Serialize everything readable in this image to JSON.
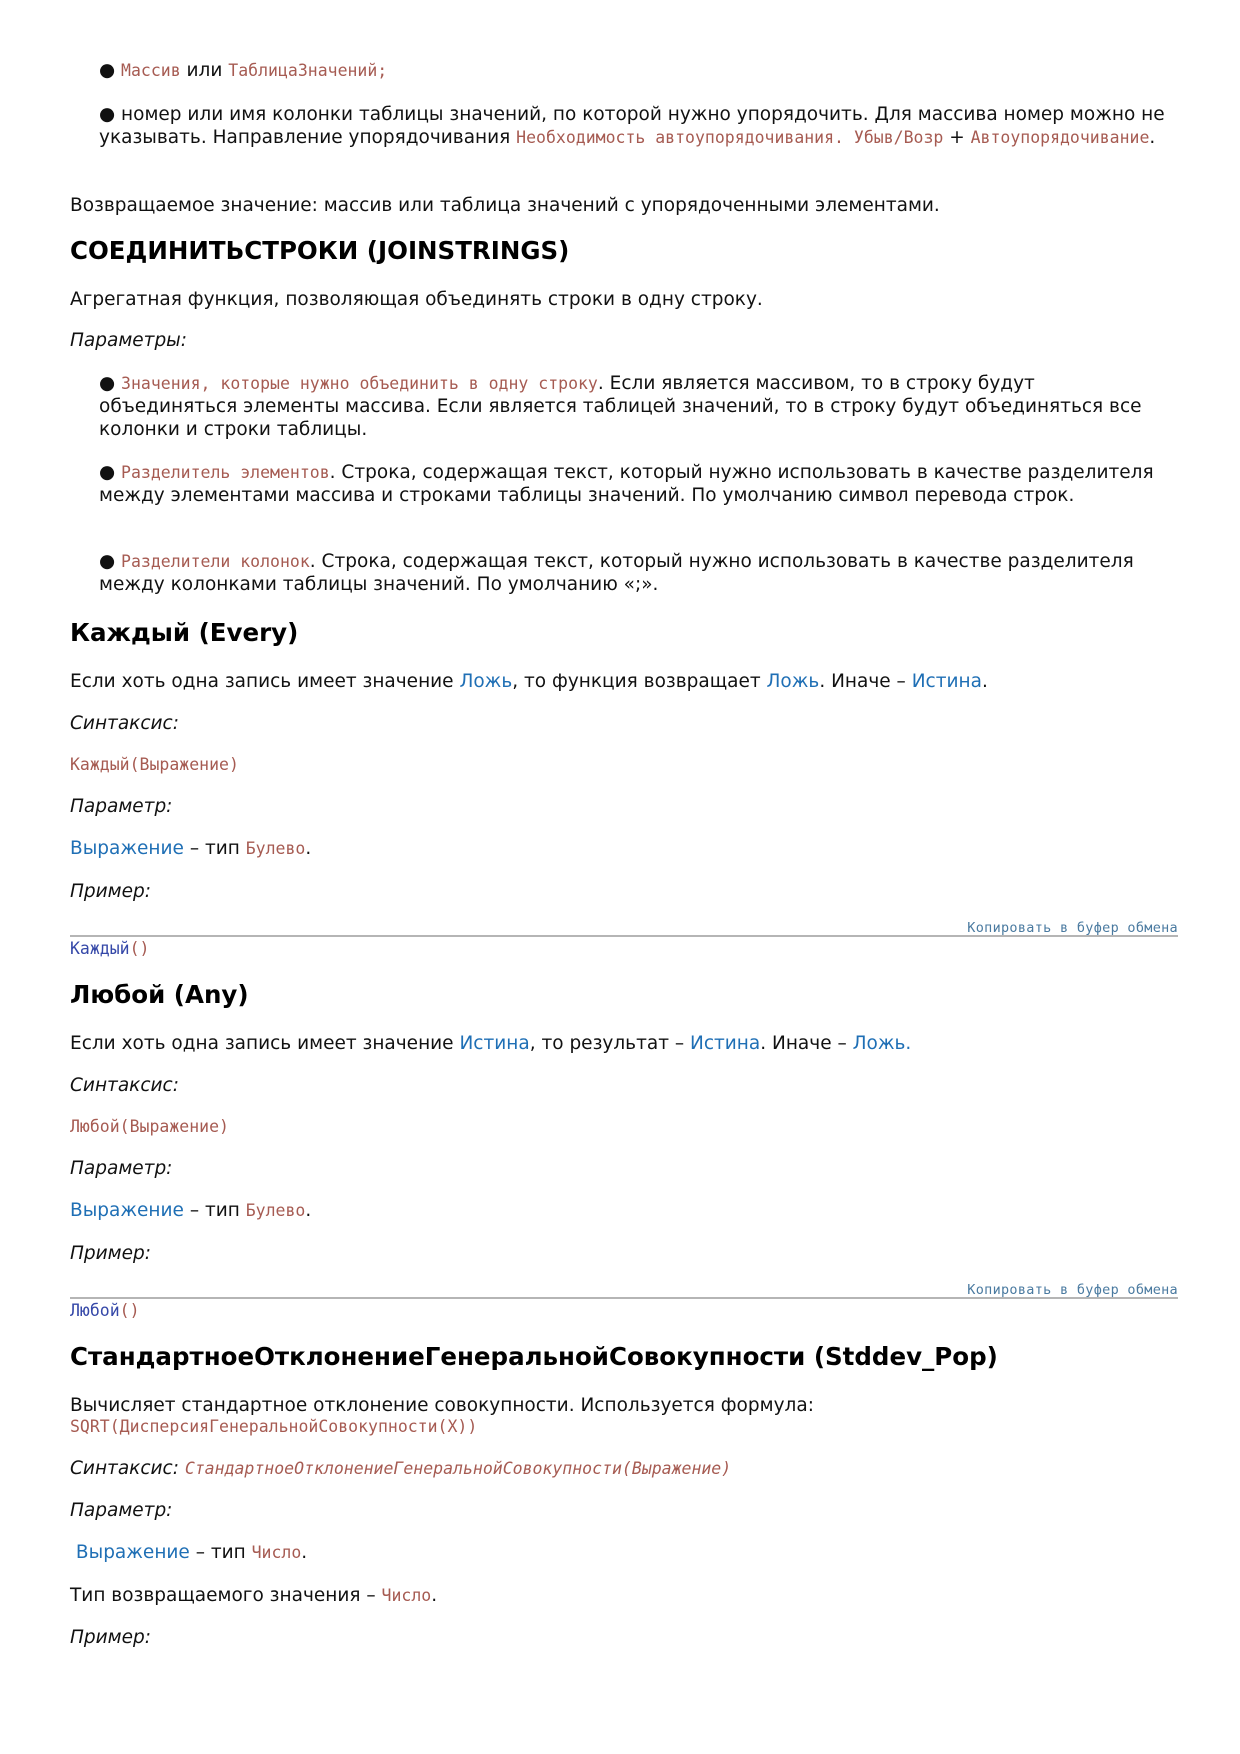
{
  "bullet": "●",
  "top": {
    "item1": {
      "code1": "Массив",
      "text1": " или ",
      "code2": "ТаблицаЗначений;"
    },
    "item2": {
      "text1": " номер или имя колонки таблицы значений, по которой нужно упорядочить. Для массива номер можно не указывать. Направление упорядочивания ",
      "code1": "Необходимость автоупорядочивания. Убыв/Возр",
      "text2": " + ",
      "code2": "Автоупорядочивание",
      "text3": "."
    },
    "return_text": "Возвращаемое значение: массив или таблица значений с упорядоченными элементами."
  },
  "joinstrings": {
    "heading": "СОЕДИНИТЬСТРОКИ (JOINSTRINGS)",
    "description": "Агрегатная функция, позволяющая объединять строки в одну строку.",
    "params_label": "Параметры:",
    "p1": {
      "code": "Значения, которые нужно объединить в одну строку",
      "text": ". Если является массивом, то в строку будут объединяться элементы массива. Если является таблицей значений, то в строку будут объединяться все колонки и строки таблицы."
    },
    "p2": {
      "code": "Разделитель элементов",
      "text": ". Строка, содержащая текст, который нужно использовать в качестве разделителя между элементами массива и строками таблицы значений. По умолчанию символ перевода строк."
    },
    "p3": {
      "code": "Разделители колонок",
      "text": ". Строка, содержащая текст, который нужно использовать в качестве разделителя между колонками таблицы значений. По умолчанию «;»."
    }
  },
  "every": {
    "heading": "Каждый (Every)",
    "desc": {
      "t1": "Если хоть одна запись имеет значение ",
      "l1": "Ложь",
      "t2": ", то функция возвращает ",
      "l2": "Ложь",
      "t3": ". Иначе – ",
      "l3": "Истина",
      "t4": "."
    },
    "syntax_label": "Синтаксис:",
    "syntax": "Каждый(Выражение)",
    "param_label": "Параметр:",
    "param": {
      "link": "Выражение",
      "text": " – тип ",
      "code": "Булево",
      "end": "."
    },
    "example_label": "Пример:",
    "copy_label": "Копировать в буфер обмена",
    "code_kw": "Каждый",
    "code_par": "()"
  },
  "any": {
    "heading": "Любой (Any)",
    "desc": {
      "t1": "Если хоть одна запись имеет значение ",
      "l1": "Истина",
      "t2": ", то результат – ",
      "l2": "Истина",
      "t3": ". Иначе – ",
      "l3": "Ложь."
    },
    "syntax_label": "Синтаксис:",
    "syntax": "Любой(Выражение)",
    "param_label": "Параметр:",
    "param": {
      "link": "Выражение",
      "text": " – тип ",
      "code": "Булево",
      "end": "."
    },
    "example_label": "Пример:",
    "copy_label": "Копировать в буфер обмена",
    "code_kw": "Любой",
    "code_par": "()"
  },
  "stddev": {
    "heading": "СтандартноеОтклонениеГенеральнойСовокупности (Stddev_Pop)",
    "desc": "Вычисляет стандартное отклонение совокупности. Используется формула:",
    "formula": "SQRT(ДисперсияГенеральнойСовокупности(X))",
    "syntax_label": "Синтаксис: ",
    "syntax": "СтандартноеОтклонениеГенеральнойСовокупности(Выражение)",
    "param_label": "Параметр:",
    "param": {
      "link": "Выражение",
      "text": " – тип ",
      "code": "Число",
      "end": "."
    },
    "return": {
      "text": "Тип возвращаемого значения – ",
      "code": "Число",
      "end": "."
    },
    "example_label": "Пример:"
  }
}
